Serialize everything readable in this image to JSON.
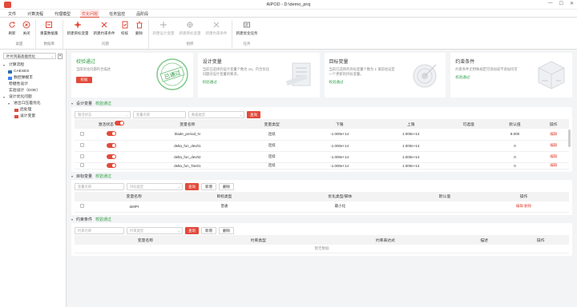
{
  "window": {
    "title": "AIPOD - D:\\demo_proj",
    "minimize": "—",
    "maximize": "☐",
    "close": "✕"
  },
  "menu": [
    "文件",
    "计算流程",
    "代理模型",
    "优化问题",
    "任务监控",
    "品阶段"
  ],
  "ribbon": {
    "groups": [
      {
        "name": "桌面",
        "buttons": [
          {
            "label": "刷新",
            "icon": "refresh-icon"
          },
          {
            "label": "关闭",
            "icon": "close-circle-icon"
          }
        ]
      },
      {
        "name": "数据库",
        "buttons": [
          {
            "label": "重置数据集",
            "icon": "reset-icon"
          }
        ]
      },
      {
        "name": "问题",
        "buttons": [
          {
            "label": "新建目标变量",
            "icon": "target-icon"
          },
          {
            "label": "新建约束条件",
            "icon": "constraint-icon"
          },
          {
            "label": "校核",
            "icon": "check-icon"
          },
          {
            "label": "删除",
            "icon": "delete-icon"
          }
        ]
      },
      {
        "name": "组织",
        "buttons": [
          {
            "label": "新建设计变量",
            "icon": "design-var-icon",
            "disabled": true
          },
          {
            "label": "新建目标变量",
            "icon": "target-var-icon",
            "disabled": true
          },
          {
            "label": "新建约束条件",
            "icon": "constraint-var-icon",
            "disabled": true
          }
        ]
      },
      {
        "name": "任务",
        "buttons": [
          {
            "label": "新建优化任务",
            "icon": "task-icon"
          }
        ]
      }
    ]
  },
  "sidebar": {
    "select_value": "叶片风扇高能优化",
    "add": "+",
    "tree": [
      {
        "label": "计算流程",
        "level": 0,
        "arrow": "▾"
      },
      {
        "label": "CAESES",
        "level": 1,
        "arrow": "",
        "color": "#2b6cb0"
      },
      {
        "label": "数控弹模丰",
        "level": 1,
        "arrow": "",
        "color": "#3b82f6"
      },
      {
        "label": "稳健性设计",
        "level": 0,
        "arrow": ""
      },
      {
        "label": "实验设计（DOE）",
        "level": 0,
        "arrow": ""
      },
      {
        "label": "设计优化问题",
        "level": 0,
        "arrow": "▾"
      },
      {
        "label": "进出口压差优化",
        "level": 1,
        "arrow": "▾"
      },
      {
        "label": "后处理",
        "level": 2,
        "arrow": "",
        "color": "#e24a3b"
      },
      {
        "label": "设计变量",
        "level": 2,
        "arrow": "",
        "color": "#e24a3b"
      }
    ]
  },
  "cards": [
    {
      "title": "校验通过",
      "title_color": "#2e9e44",
      "desc": "当前优化问题符合描述",
      "button": "校核",
      "stamp": "已通过"
    },
    {
      "title": "设计变量",
      "desc": "当前已选择的设计变量个数为 16，符合优化问题对设计变量的要求。",
      "status": "校验通过"
    },
    {
      "title": "目标变量",
      "desc": "当前已选择的目标变量个数为 1 请前往设定一个更新的目标变量。",
      "status": "校验通过"
    },
    {
      "title": "约束条件",
      "desc": "约束条件无特殊规定可添加或不添加均可",
      "status": "校验通过"
    }
  ],
  "design_section": {
    "title": "设计变量",
    "status": "校验通过",
    "filters": {
      "f1": "激活状态",
      "f2": "变量名称",
      "f3": "数据类型",
      "query": "查询"
    },
    "headers": [
      "",
      "激活状态",
      "变量名称",
      "变量类型",
      "下限",
      "上限",
      "可选值",
      "默认值",
      "操作"
    ],
    "rows": [
      {
        "name": "blade_period_N",
        "type": "连续",
        "lower": "-1.000e+14",
        "upper": "1.000e+14",
        "options": "",
        "default": "8.000",
        "op": "编辑"
      },
      {
        "name": "delta_fun_dev01",
        "type": "连续",
        "lower": "-1.000e+14",
        "upper": "1.000e+14",
        "options": "",
        "default": "0",
        "op": "编辑"
      },
      {
        "name": "delta_fun_dev02",
        "type": "连续",
        "lower": "-1.000e+14",
        "upper": "1.000e+14",
        "options": "",
        "default": "0",
        "op": "编辑"
      },
      {
        "name": "delta_fun_Tan01",
        "type": "连续",
        "lower": "-1.000e+14",
        "upper": "1.000e+14",
        "options": "",
        "default": "0",
        "op": "编辑"
      }
    ]
  },
  "target_section": {
    "title": "目标变量",
    "status": "校验通过",
    "filters": {
      "f1": "变量名称",
      "f2": "目标类型",
      "query": "查询",
      "add": "新增",
      "delete": "删除"
    },
    "headers": [
      "",
      "变量名称",
      "目标类型",
      "优化类型/脚本",
      "默认值",
      "操作"
    ],
    "rows": [
      {
        "name": "deltPt",
        "type": "普通",
        "opt": "最小化",
        "default": "",
        "op_edit": "编辑",
        "op_delete": "删除"
      }
    ]
  },
  "constraint_section": {
    "title": "约束条件",
    "status": "校验通过",
    "filters": {
      "f1": "约束名称",
      "f2": "约束类型",
      "query": "查询",
      "add": "新增",
      "delete": "删除"
    },
    "headers": [
      "",
      "变量名称",
      "约束类型",
      "约束表达式",
      "描述",
      "操作"
    ],
    "empty": "暂无数据"
  },
  "colors": {
    "accent": "#e24a3b",
    "success": "#2e9e44"
  }
}
